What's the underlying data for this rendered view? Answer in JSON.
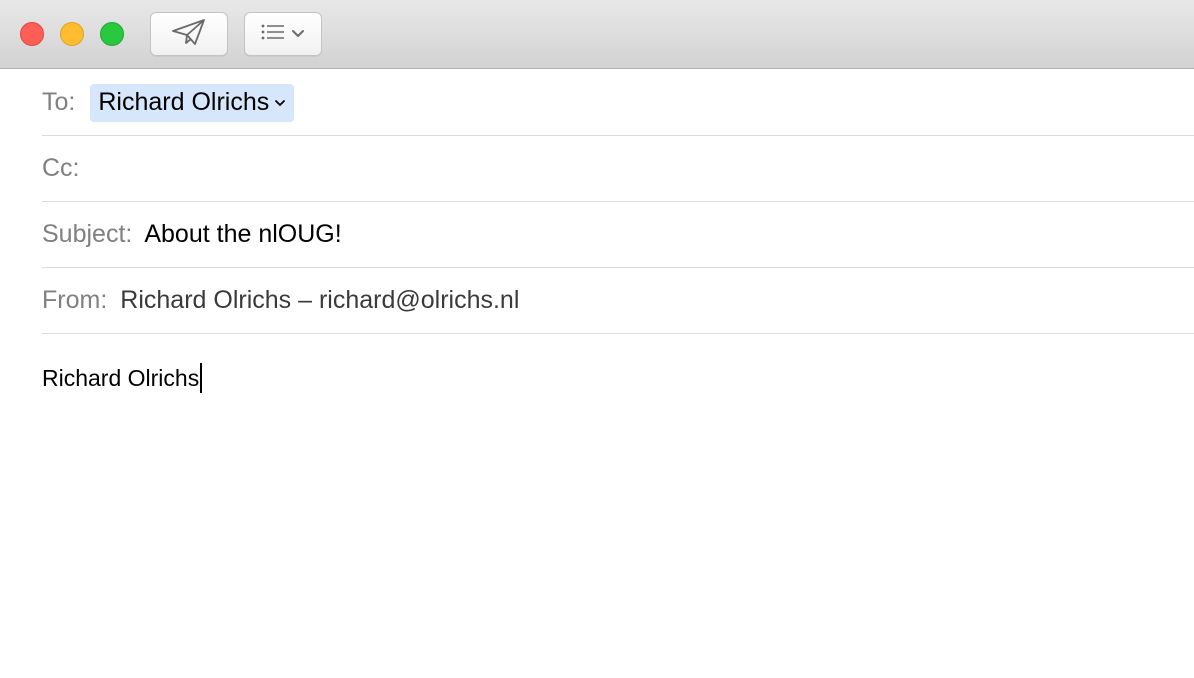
{
  "toolbar": {
    "window_controls": [
      "close",
      "minimize",
      "zoom"
    ],
    "send_icon": "paper-plane-icon",
    "format_icon": "list-icon",
    "format_dropdown_icon": "chevron-down-icon"
  },
  "fields": {
    "to": {
      "label": "To:",
      "recipient": "Richard Olrichs",
      "token_color": "#d6e7fb"
    },
    "cc": {
      "label": "Cc:"
    },
    "subject": {
      "label": "Subject:",
      "value": "About the nlOUG!"
    },
    "from": {
      "label": "From:",
      "value": "Richard Olrichs – richard@olrichs.nl"
    }
  },
  "body": {
    "text": "Richard Olrichs"
  },
  "colors": {
    "close": "#fd5f57",
    "minimize": "#febc2e",
    "zoom": "#28c840"
  }
}
